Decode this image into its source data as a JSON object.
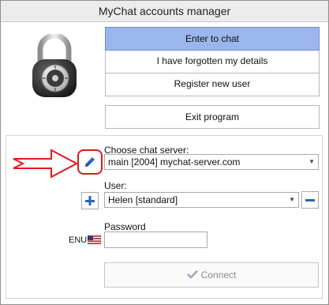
{
  "window": {
    "title": "MyChat accounts manager"
  },
  "menu": {
    "enter_chat": "Enter to chat",
    "forgot": "I have forgotten my details",
    "register": "Register new user",
    "exit": "Exit program"
  },
  "server": {
    "label": "Choose chat server:",
    "value": "main [2004] mychat-server.com"
  },
  "user": {
    "label": "User:",
    "value": "Helen [standard]"
  },
  "password": {
    "label": "Password",
    "value": "",
    "layout_indicator": "ENU"
  },
  "connect": {
    "label": "Connect"
  },
  "icons": {
    "lock": "padlock-icon",
    "edit": "pencil-icon",
    "add": "plus-icon",
    "remove": "minus-icon",
    "flag": "us-flag-icon",
    "check": "check-icon",
    "arrow": "red-arrow-annotation"
  },
  "colors": {
    "primary_button": "#9ab6ec",
    "accent": "#2b63b7",
    "annotation": "#e0191b"
  }
}
